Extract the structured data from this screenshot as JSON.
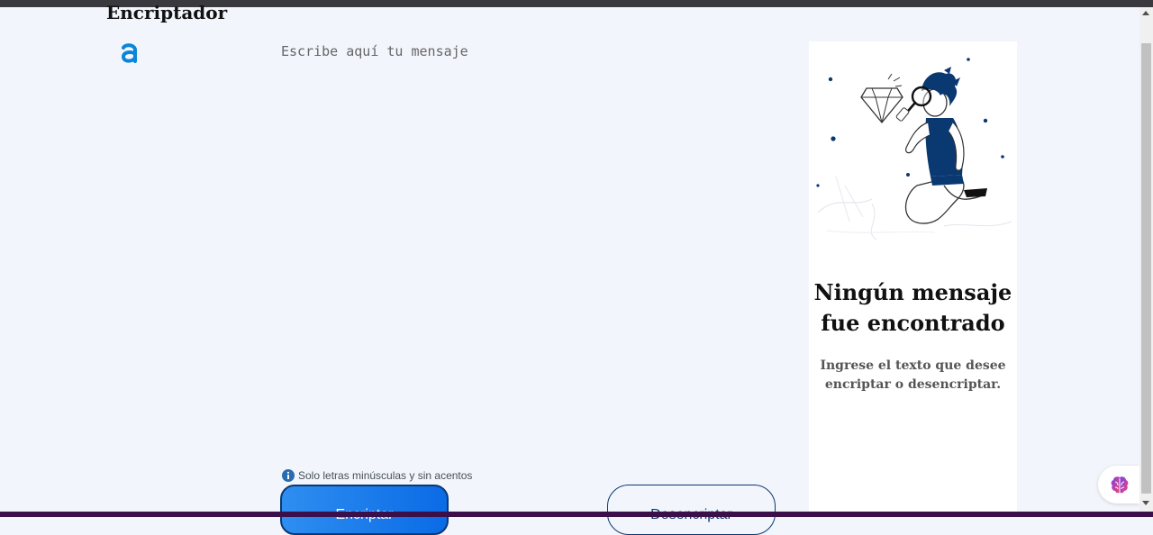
{
  "app": {
    "title": "Encriptador",
    "logo_icon": "alura-logo-icon"
  },
  "input": {
    "placeholder": "Escribe aquí tu mensaje",
    "value": ""
  },
  "hint": {
    "icon": "info-icon",
    "text": "Solo letras minúsculas y sin acentos"
  },
  "buttons": {
    "encrypt_label": "Encriptar",
    "decrypt_label": "Desencriptar"
  },
  "output_panel": {
    "illustration": "person-with-magnifying-glass-illustration",
    "title": "Ningún mensaje fue encontrado",
    "subtitle": "Ingrese el texto que desee encriptar o desencriptar."
  },
  "floating_widget": {
    "icon": "brain-icon"
  },
  "colors": {
    "background": "#f3f5fc",
    "primary": "#0a3871",
    "accent_blue": "#0a6be6",
    "logo_blue": "#0a86d8"
  }
}
